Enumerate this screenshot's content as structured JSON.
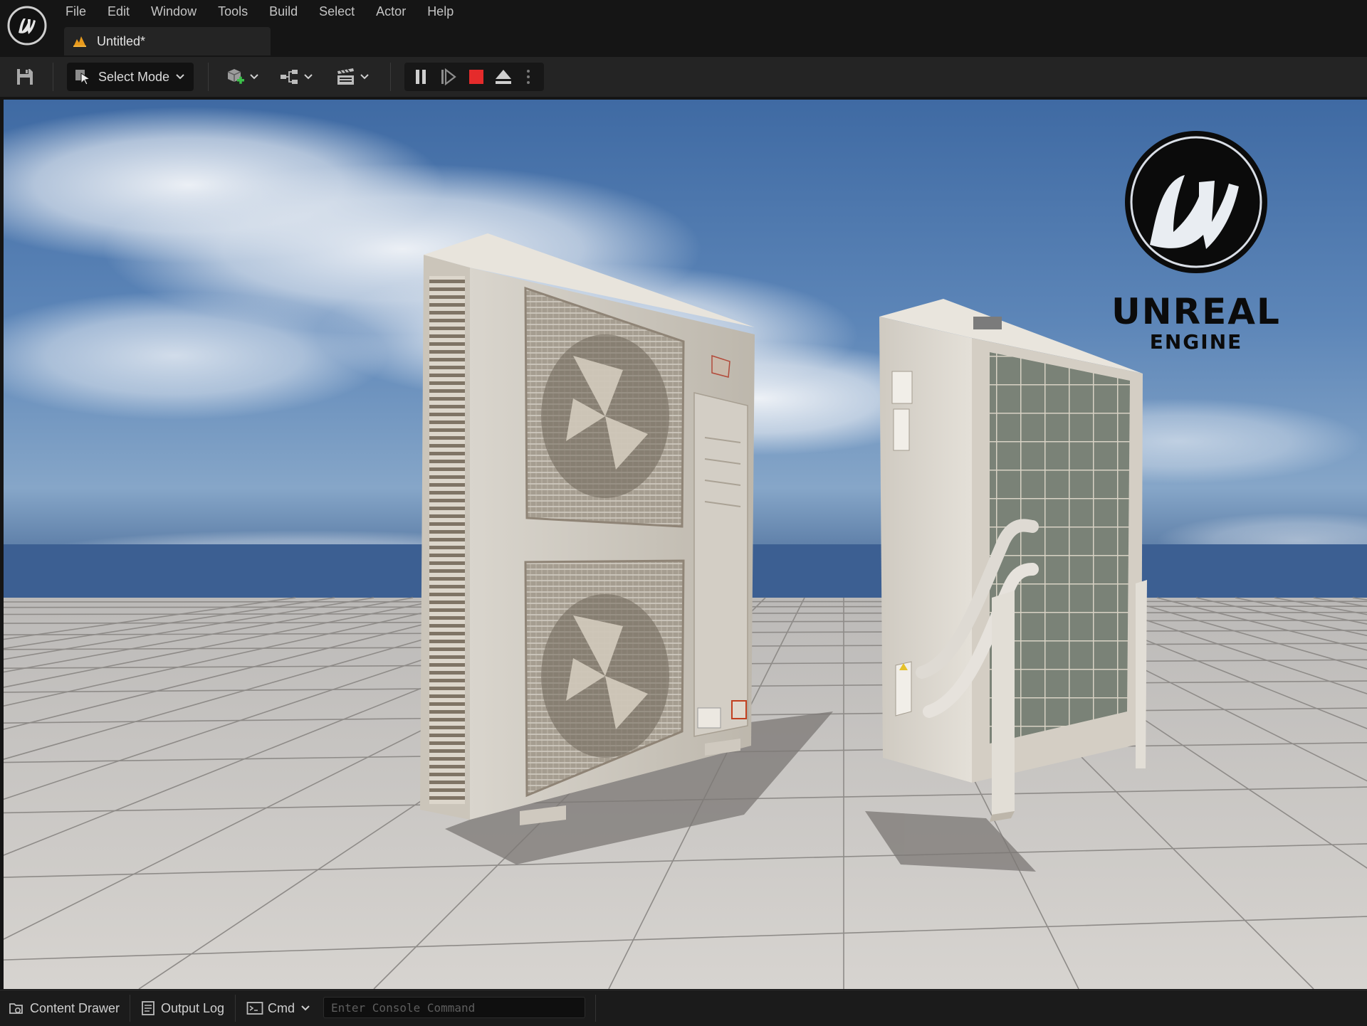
{
  "app": {
    "menu": [
      "File",
      "Edit",
      "Window",
      "Tools",
      "Build",
      "Select",
      "Actor",
      "Help"
    ],
    "document_tab": {
      "label": "Untitled*"
    }
  },
  "toolbar": {
    "save_icon": "save-icon",
    "select_mode_label": "Select Mode",
    "add_icon": "add-actor-icon",
    "blueprint_icon": "blueprint-icon",
    "cinematics_icon": "cinematics-icon",
    "play_controls": [
      "pause-icon",
      "step-frame-icon",
      "stop-icon",
      "eject-icon",
      "more-options-icon"
    ],
    "stop_color": "#e52b2b"
  },
  "viewport": {
    "watermark": {
      "line1": "UNREAL",
      "line2": "ENGINE"
    },
    "sky_color": "#4f79ad",
    "floor_color": "#c9c6c2"
  },
  "statusbar": {
    "content_drawer_label": "Content Drawer",
    "output_log_label": "Output Log",
    "cmd_label": "Cmd",
    "console_placeholder": "Enter Console Command"
  }
}
